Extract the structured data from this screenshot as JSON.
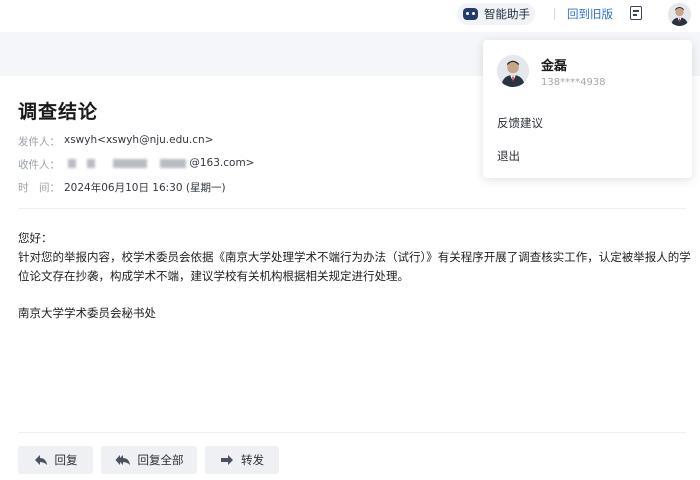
{
  "topbar": {
    "assistant_label": "智能助手",
    "old_version_label": "回到旧版"
  },
  "mail": {
    "subject": "调查结论",
    "from_label": "发件人：",
    "from_value": "xswyh<xswyh@nju.edu.cn>",
    "to_label": "收件人：",
    "to_value_suffix": "@163.com>",
    "time_label": "时　间：",
    "time_value": "2024年06月10日 16:30 (星期一)",
    "greeting": "您好：",
    "body_line1": "针对您的举报内容，校学术委员会依据《南京大学处理学术不端行为办法（试行）》有关程序开展了调查核实工作，认定被举报人的学",
    "body_line2": "位论文存在抄袭，构成学术不端，建议学校有关机构根据相关规定进行处理。",
    "signature": "南京大学学术委员会秘书处"
  },
  "actions": {
    "reply": "回复",
    "reply_all": "回复全部",
    "forward": "转发"
  },
  "user_menu": {
    "name": "金磊",
    "phone": "138****4938",
    "feedback": "反馈建议",
    "logout": "退出"
  }
}
